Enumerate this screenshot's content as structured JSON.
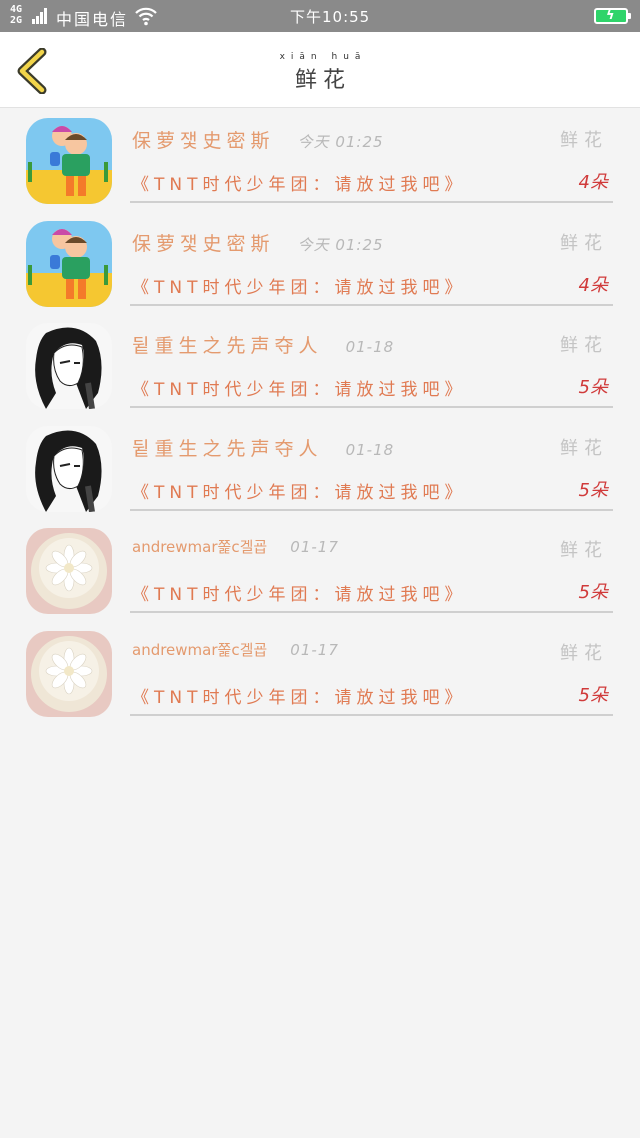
{
  "status_bar": {
    "network": "4G",
    "network2": "2G",
    "carrier": "中国电信",
    "time": "下午10:55",
    "battery_color": "#2fd46a"
  },
  "header": {
    "back_icon": "chevron-left-icon",
    "title_pinyin": "xiān huā",
    "title": "鲜花"
  },
  "records": [
    {
      "avatar": "cartoon-kids",
      "name": "保萝쟃史密斯",
      "date": "今天 01:25",
      "gift": "鲜花",
      "song": "《TNT时代少年团：请放过我吧》",
      "count": "4朵"
    },
    {
      "avatar": "cartoon-kids",
      "name": "保萝쟃史密斯",
      "date": "今天 01:25",
      "gift": "鲜花",
      "song": "《TNT时代少年团：请放过我吧》",
      "count": "4朵"
    },
    {
      "avatar": "manga-girl",
      "name": "뒽重生之先声夺人",
      "date": "01-18",
      "gift": "鲜花",
      "song": "《TNT时代少年团：请放过我吧》",
      "count": "5朵"
    },
    {
      "avatar": "manga-girl",
      "name": "뒽重生之先声夺人",
      "date": "01-18",
      "gift": "鲜花",
      "song": "《TNT时代少年团：请放过我吧》",
      "count": "5朵"
    },
    {
      "avatar": "white-flower",
      "name": "andrewmar쫉c겔굡",
      "date": "01-17",
      "gift": "鲜花",
      "song": "《TNT时代少年团：请放过我吧》",
      "count": "5朵"
    },
    {
      "avatar": "white-flower",
      "name": "andrewmar쫉c겔굡",
      "date": "01-17",
      "gift": "鲜花",
      "song": "《TNT时代少年团：请放过我吧》",
      "count": "5朵"
    }
  ]
}
